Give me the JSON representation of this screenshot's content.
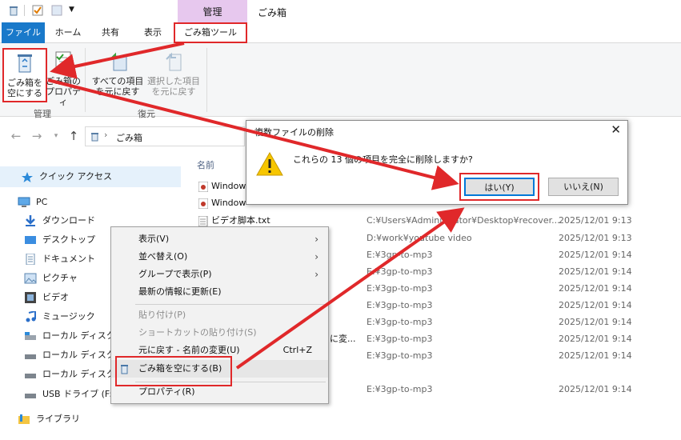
{
  "titlebar": {
    "context_tab": "管理",
    "title": "ごみ箱"
  },
  "tabs": [
    {
      "label": "ファイル"
    },
    {
      "label": "ホーム"
    },
    {
      "label": "共有"
    },
    {
      "label": "表示"
    },
    {
      "label": "ごみ箱ツール"
    }
  ],
  "ribbon": {
    "empty_bin": {
      "line1": "ごみ箱を",
      "line2": "空にする"
    },
    "bin_props": {
      "line1": "ごみ箱の",
      "line2": "プロパティ"
    },
    "group_manage": "管理",
    "restore_all": {
      "line1": "すべての項目",
      "line2": "を元に戻す"
    },
    "restore_selected": {
      "line1": "選択した項目",
      "line2": "を元に戻す"
    },
    "group_restore": "復元"
  },
  "address": {
    "location": "ごみ箱"
  },
  "sidebar": {
    "items": [
      {
        "label": "クイック アクセス"
      },
      {
        "label": "PC"
      },
      {
        "label": "ダウンロード"
      },
      {
        "label": "デスクトップ"
      },
      {
        "label": "ドキュメント"
      },
      {
        "label": "ピクチャ"
      },
      {
        "label": "ビデオ"
      },
      {
        "label": "ミュージック"
      },
      {
        "label": "ローカル ディスク (C"
      },
      {
        "label": "ローカル ディスク (D"
      },
      {
        "label": "ローカル ディスク (E"
      },
      {
        "label": "USB ドライブ (F:)"
      },
      {
        "label": "ライブラリ"
      }
    ]
  },
  "filelist": {
    "col_name": "名前",
    "rows": [
      {
        "name": "Window",
        "path": "",
        "date": ""
      },
      {
        "name": "Window",
        "path": "",
        "date": ""
      },
      {
        "name": "ビデオ脚本.txt",
        "path": "C:¥Users¥Administrator¥Desktop¥recover...",
        "date": "2025/12/01 9:13"
      },
      {
        "name": "",
        "path": "D:¥work¥youtube video",
        "date": "2025/12/01 9:13"
      },
      {
        "name": "",
        "path": "E:¥3gp-to-mp3",
        "date": "2025/12/01 9:14"
      },
      {
        "name": "",
        "path": "E:¥3gp-to-mp3",
        "date": "2025/12/01 9:14"
      },
      {
        "name": "",
        "path": "E:¥3gp-to-mp3",
        "date": "2025/12/01 9:14"
      },
      {
        "name": "",
        "path": "E:¥3gp-to-mp3",
        "date": "2025/12/01 9:14"
      },
      {
        "name": "",
        "path": "E:¥3gp-to-mp3",
        "date": "2025/12/01 9:14"
      },
      {
        "name": "",
        "path": "E:¥3gp-to-mp3",
        "date": "2025/12/01 9:14"
      },
      {
        "name": "",
        "path": "E:¥3gp-to-mp3",
        "date": "2025/12/01 9:14"
      },
      {
        "name": "",
        "path": "E:¥3gp-to-mp3",
        "date": "2025/12/01 9:14"
      }
    ],
    "partial_name": "に変..."
  },
  "context_menu": {
    "view": "表示(V)",
    "sort": "並べ替え(O)",
    "group": "グループで表示(P)",
    "refresh": "最新の情報に更新(E)",
    "paste": "貼り付け(P)",
    "paste_shortcut": "ショートカットの貼り付け(S)",
    "undo": "元に戻す - 名前の変更(U)",
    "undo_shortcut": "Ctrl+Z",
    "empty_bin": "ごみ箱を空にする(B)",
    "properties": "プロパティ(R)"
  },
  "dialog": {
    "title": "複数ファイルの削除",
    "message": "これらの 13 個の項目を完全に削除しますか?",
    "yes": "はい(Y)",
    "no": "いいえ(N)"
  },
  "colors": {
    "accent_file_tab": "#1979ca",
    "context_tab": "#e7c8ee",
    "highlight": "#e0282a"
  }
}
